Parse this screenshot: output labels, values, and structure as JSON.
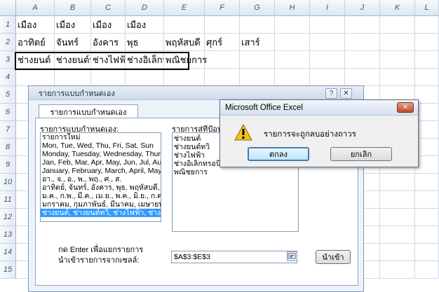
{
  "sheet": {
    "columns": [
      "A",
      "B",
      "C",
      "D",
      "E",
      "F",
      "G",
      "H",
      "I",
      "J",
      "K",
      "L"
    ],
    "rows": [
      "1",
      "2",
      "3",
      "4",
      "5",
      "6",
      "7",
      "8",
      "9",
      "10",
      "11",
      "12",
      "13",
      "14",
      "15"
    ],
    "row1": [
      "เมือง",
      "เมือง",
      "เมือง",
      "เมือง"
    ],
    "row2": [
      "อาทิตย์",
      "จันทร์",
      "อังคาร",
      "พุธ",
      "พฤหัสบดี",
      "ศุกร์",
      "เสาร์"
    ],
    "row3": [
      "ช่างยนต์",
      "ช่างยนต์ทวิ",
      "ช่างไฟฟ้า",
      "ช่างอิเล็กทรอนิกส์",
      "พณิชยการ"
    ]
  },
  "custom_dialog": {
    "title": "รายการแบบกำหนดเอง",
    "help_button": "?",
    "close_button": "✕",
    "tab_label": "รายการแบบกำหนดเอง",
    "custom_lists_label": "รายการแบบกำหนดเอง:",
    "custom_lists": [
      "รายการใหม่",
      "Mon, Tue, Wed, Thu, Fri, Sat, Sun",
      "Monday, Tuesday, Wednesday, Thur",
      "Jan, Feb, Mar, Apr, May, Jun, Jul, Au",
      "January, February, March, April, May",
      "อา., จ., อ., พ., พฤ., ศ., ส.",
      "อาทิตย์, จันทร์, อังคาร, พุธ, พฤหัสบดี, ศุกร์, เสาร์",
      "ม.ค., ก.พ., มี.ค., เม.ย., พ.ค., มิ.ย., ก.ค.",
      "มกราคม, กุมภาพันธ์, มีนาคม, เมษายน, พฤษภาคม",
      "ช่างยนต์, ช่างยนต์ทวิ, ช่างไฟฟ้า, ช่างอิเล็กทรอนิกส์"
    ],
    "selected_index": 9,
    "entries_label": "รายการสู่ทีป้อน:",
    "entries": [
      "ช่างยนต์",
      "ช่างยนต์ทวิ",
      "ช่างไฟฟ้า",
      "ช่างอิเล็กทรอนิกส์",
      "พณิชยการ"
    ],
    "hint_line1": "กด Enter เพื่อแยกรายการ",
    "import_label": "นำเข้ารายการจากเซลล์:",
    "import_range": "$A$3:$E$3",
    "import_button": "นำเข้า"
  },
  "msg_dialog": {
    "title": "Microsoft Office Excel",
    "close_button": "✕",
    "message": "รายการจะถูกลบอย่างถาวร",
    "ok_button": "ตกลง",
    "cancel_button": "ยกเลิก"
  }
}
